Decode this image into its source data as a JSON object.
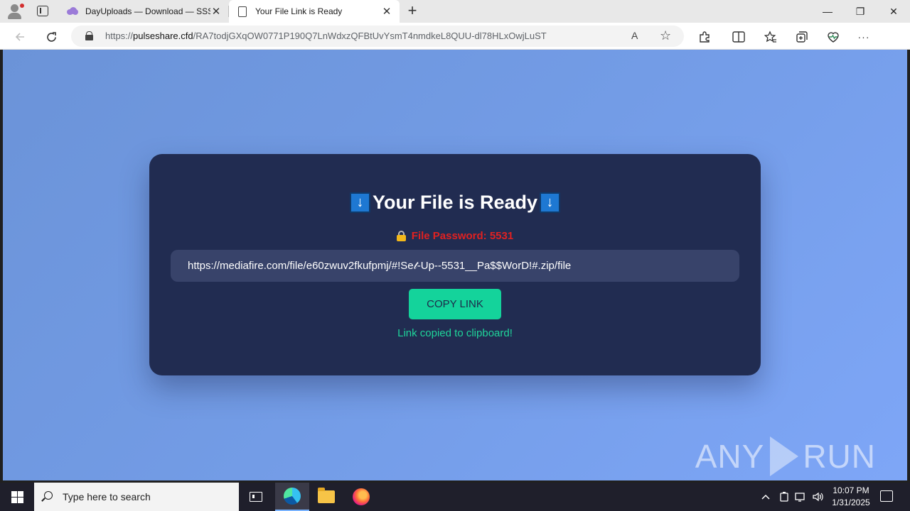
{
  "browser": {
    "tabs": [
      {
        "title": "DayUploads — Download — SSS"
      },
      {
        "title": "Your File Link is Ready"
      }
    ],
    "address": {
      "scheme": "https://",
      "host": "pulseshare.cfd",
      "path": "/RA7todjGXqOW0771P190Q7LnWdxzQFBtUvYsmT4nmdkeL8QUU-dl78HLxOwjLuST"
    },
    "controls": {
      "newtab": "+",
      "minimize": "—",
      "maximize": "❐",
      "close": "✕",
      "tab_close": "✕",
      "read_aloud": "A",
      "favorite": "☆",
      "more": "···"
    }
  },
  "page": {
    "title": "Your File is Ready",
    "title_icon": "↓",
    "password_label": "File Password: 5531",
    "link": "https://mediafire.com/file/e60zwuv2fkufpmj/#!Se𝓉-Up--5531__Pa$$WorD!#.zip/file",
    "copy_button": "COPY LINK",
    "status": "Link copied to clipboard!"
  },
  "watermark": {
    "left": "ANY",
    "right": "RUN"
  },
  "taskbar": {
    "search_placeholder": "Type here to search",
    "time": "10:07 PM",
    "date": "1/31/2025"
  }
}
